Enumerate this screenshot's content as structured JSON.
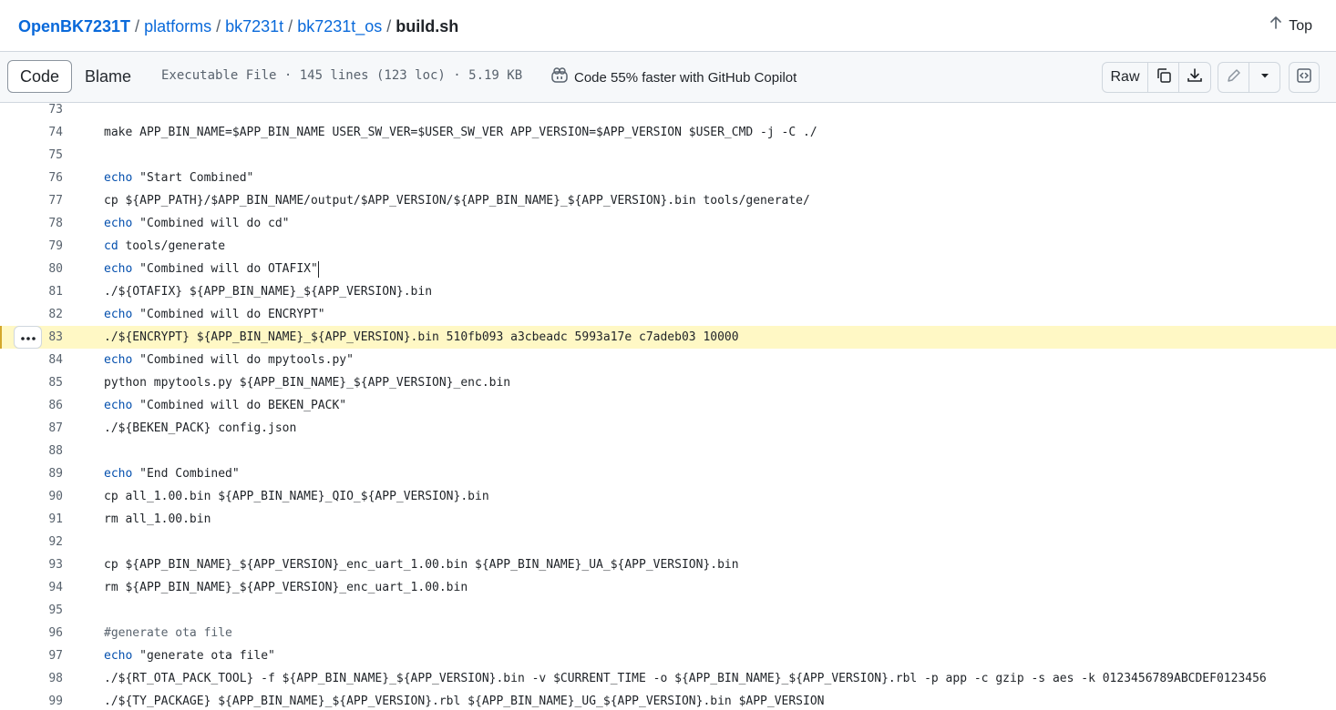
{
  "breadcrumb": {
    "owner": "OpenBK7231T",
    "parts": [
      "platforms",
      "bk7231t",
      "bk7231t_os"
    ],
    "file": "build.sh"
  },
  "top_link": "Top",
  "toolbar": {
    "code_tab": "Code",
    "blame_tab": "Blame",
    "file_info": "Executable File · 145 lines (123 loc) · 5.19 KB",
    "copilot_text": "Code 55% faster with GitHub Copilot",
    "raw_label": "Raw"
  },
  "icons": {
    "top": "arrow-up-icon",
    "copilot": "copilot-icon",
    "copy": "copy-icon",
    "download": "download-icon",
    "edit": "pencil-icon",
    "dropdown": "triangle-down-icon",
    "symbols": "code-square-icon",
    "line_menu": "kebab-horizontal-icon"
  },
  "colors": {
    "link": "#0969da",
    "keyword": "#0550ae",
    "highlight": "#fff8c5"
  },
  "code": {
    "highlighted_line": 83,
    "lines": [
      {
        "n": "73",
        "t": ""
      },
      {
        "n": "74",
        "t": "make APP_BIN_NAME=$APP_BIN_NAME USER_SW_VER=$USER_SW_VER APP_VERSION=$APP_VERSION $USER_CMD -j -C ./"
      },
      {
        "n": "75",
        "t": ""
      },
      {
        "n": "76",
        "k": "echo",
        "t": " \"Start Combined\""
      },
      {
        "n": "77",
        "t": "cp ${APP_PATH}/$APP_BIN_NAME/output/$APP_VERSION/${APP_BIN_NAME}_${APP_VERSION}.bin tools/generate/"
      },
      {
        "n": "78",
        "k": "echo",
        "t": " \"Combined will do cd\""
      },
      {
        "n": "79",
        "k": "cd",
        "t": " tools/generate"
      },
      {
        "n": "80",
        "k": "echo",
        "t": " \"Combined will do OTAFIX\""
      },
      {
        "n": "81",
        "t": "./${OTAFIX} ${APP_BIN_NAME}_${APP_VERSION}.bin"
      },
      {
        "n": "82",
        "k": "echo",
        "t": " \"Combined will do ENCRYPT\""
      },
      {
        "n": "83",
        "t": "./${ENCRYPT} ${APP_BIN_NAME}_${APP_VERSION}.bin 510fb093 a3cbeadc 5993a17e c7adeb03 10000"
      },
      {
        "n": "84",
        "k": "echo",
        "t": " \"Combined will do mpytools.py\""
      },
      {
        "n": "85",
        "t": "python mpytools.py ${APP_BIN_NAME}_${APP_VERSION}_enc.bin"
      },
      {
        "n": "86",
        "k": "echo",
        "t": " \"Combined will do BEKEN_PACK\""
      },
      {
        "n": "87",
        "t": "./${BEKEN_PACK} config.json"
      },
      {
        "n": "88",
        "t": ""
      },
      {
        "n": "89",
        "k": "echo",
        "t": " \"End Combined\""
      },
      {
        "n": "90",
        "t": "cp all_1.00.bin ${APP_BIN_NAME}_QIO_${APP_VERSION}.bin"
      },
      {
        "n": "91",
        "t": "rm all_1.00.bin"
      },
      {
        "n": "92",
        "t": ""
      },
      {
        "n": "93",
        "t": "cp ${APP_BIN_NAME}_${APP_VERSION}_enc_uart_1.00.bin ${APP_BIN_NAME}_UA_${APP_VERSION}.bin"
      },
      {
        "n": "94",
        "t": "rm ${APP_BIN_NAME}_${APP_VERSION}_enc_uart_1.00.bin"
      },
      {
        "n": "95",
        "t": ""
      },
      {
        "n": "96",
        "c": true,
        "t": "#generate ota file"
      },
      {
        "n": "97",
        "k": "echo",
        "t": " \"generate ota file\""
      },
      {
        "n": "98",
        "t": "./${RT_OTA_PACK_TOOL} -f ${APP_BIN_NAME}_${APP_VERSION}.bin -v $CURRENT_TIME -o ${APP_BIN_NAME}_${APP_VERSION}.rbl -p app -c gzip -s aes -k 0123456789ABCDEF0123456"
      },
      {
        "n": "99",
        "t": "./${TY_PACKAGE} ${APP_BIN_NAME}_${APP_VERSION}.rbl ${APP_BIN_NAME}_UG_${APP_VERSION}.bin $APP_VERSION"
      }
    ]
  }
}
